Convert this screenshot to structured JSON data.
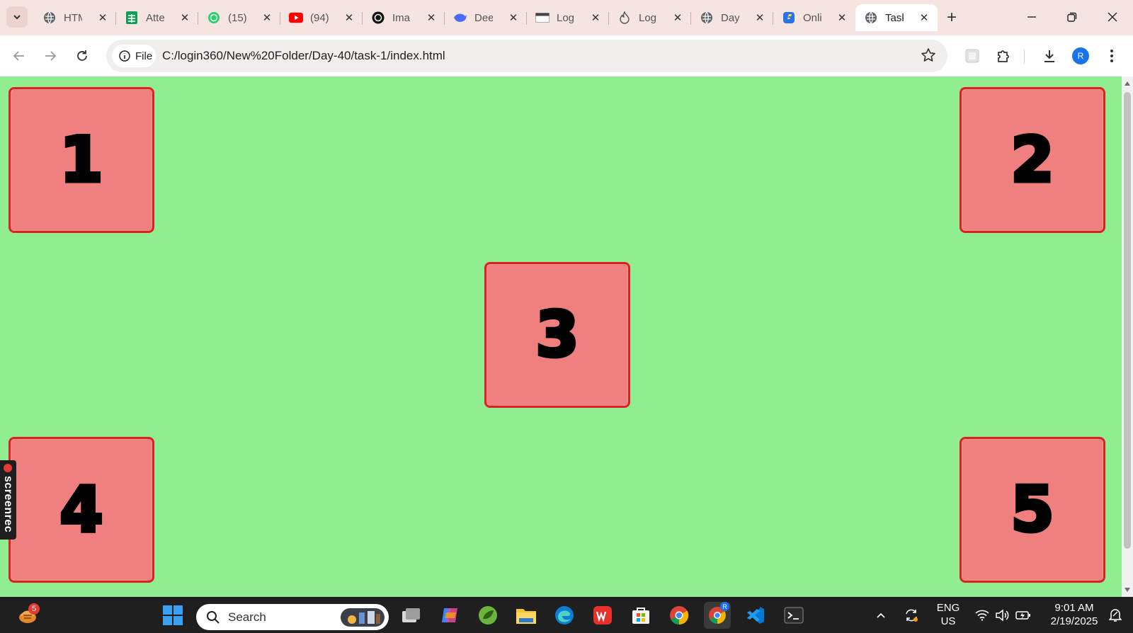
{
  "browser": {
    "tabs": [
      {
        "title": "HTM",
        "icon": "globe-icon"
      },
      {
        "title": "Atte",
        "icon": "sheets-icon"
      },
      {
        "title": "(15)",
        "icon": "whatsapp-icon"
      },
      {
        "title": "(94)",
        "icon": "youtube-icon"
      },
      {
        "title": "Ima",
        "icon": "openai-icon"
      },
      {
        "title": "Dee",
        "icon": "deepseek-icon"
      },
      {
        "title": "Log",
        "icon": "page-icon"
      },
      {
        "title": "Log",
        "icon": "flame-icon"
      },
      {
        "title": "Day",
        "icon": "globe-icon"
      },
      {
        "title": "Onli",
        "icon": "flipkart-icon"
      },
      {
        "title": "Task",
        "icon": "globe-icon",
        "active": true
      }
    ],
    "address": {
      "chip_label": "File",
      "url": "C:/login360/New%20Folder/Day-40/task-1/index.html"
    },
    "profile_initial": "R"
  },
  "page": {
    "background": "#90ee90",
    "box_color": "#f08080",
    "border_color": "#e02020",
    "boxes": [
      "1",
      "2",
      "3",
      "4",
      "5"
    ],
    "overlay_label": "screenrec"
  },
  "taskbar": {
    "widget_badge": "5",
    "search_placeholder": "Search",
    "language": "ENG",
    "region": "US",
    "time": "9:01 AM",
    "date": "2/19/2025",
    "chrome_profile_badge": "R"
  }
}
